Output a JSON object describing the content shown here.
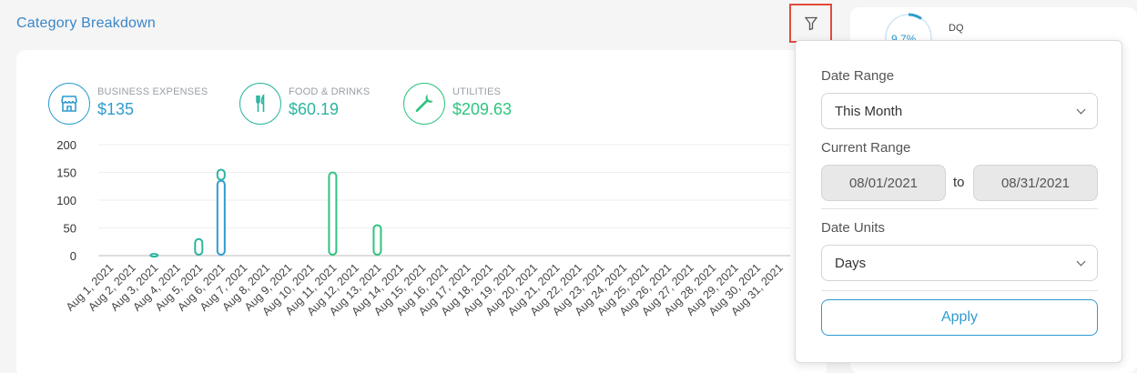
{
  "section_title": "Category Breakdown",
  "summary": [
    {
      "label": "BUSINESS EXPENSES",
      "value": "$135",
      "icon": "store-icon"
    },
    {
      "label": "FOOD & DRINKS",
      "value": "$60.19",
      "icon": "fork-knife-icon"
    },
    {
      "label": "UTILITIES",
      "value": "$209.63",
      "icon": "wrench-icon"
    }
  ],
  "colors": {
    "business": "#2e9ccf",
    "food": "#2bb5a0",
    "utilities": "#2ec47e",
    "accent": "#3a86c8"
  },
  "right_card": {
    "percent": "9.7%",
    "label": "DQ"
  },
  "filter": {
    "date_range_label": "Date Range",
    "date_range_value": "This Month",
    "current_range_label": "Current Range",
    "start_date": "08/01/2021",
    "to_label": "to",
    "end_date": "08/31/2021",
    "date_units_label": "Date Units",
    "date_units_value": "Days",
    "apply_label": "Apply"
  },
  "chart_data": {
    "type": "bar",
    "ylim": [
      0,
      200
    ],
    "yticks": [
      0,
      50,
      100,
      150,
      200
    ],
    "categories": [
      "Aug 1, 2021",
      "Aug 2, 2021",
      "Aug 3, 2021",
      "Aug 4, 2021",
      "Aug 5, 2021",
      "Aug 6, 2021",
      "Aug 7, 2021",
      "Aug 8, 2021",
      "Aug 9, 2021",
      "Aug 10, 2021",
      "Aug 11, 2021",
      "Aug 12, 2021",
      "Aug 13, 2021",
      "Aug 14, 2021",
      "Aug 15, 2021",
      "Aug 16, 2021",
      "Aug 17, 2021",
      "Aug 18, 2021",
      "Aug 19, 2021",
      "Aug 20, 2021",
      "Aug 21, 2021",
      "Aug 22, 2021",
      "Aug 23, 2021",
      "Aug 24, 2021",
      "Aug 25, 2021",
      "Aug 26, 2021",
      "Aug 27, 2021",
      "Aug 28, 2021",
      "Aug 29, 2021",
      "Aug 30, 2021",
      "Aug 31, 2021"
    ],
    "stacked": true,
    "series": [
      {
        "name": "BUSINESS EXPENSES",
        "color": "#2e9ccf",
        "values": [
          0,
          0,
          0,
          0,
          0,
          135,
          0,
          0,
          0,
          0,
          0,
          0,
          0,
          0,
          0,
          0,
          0,
          0,
          0,
          0,
          0,
          0,
          0,
          0,
          0,
          0,
          0,
          0,
          0,
          0,
          0
        ]
      },
      {
        "name": "FOOD & DRINKS",
        "color": "#2bb5a0",
        "values": [
          0,
          0,
          3,
          0,
          30,
          20,
          0,
          0,
          0,
          0,
          0,
          0,
          0,
          0,
          0,
          0,
          0,
          0,
          0,
          0,
          0,
          0,
          0,
          0,
          0,
          0,
          0,
          0,
          0,
          0,
          0
        ]
      },
      {
        "name": "UTILITIES",
        "color": "#2ec47e",
        "values": [
          0,
          0,
          0,
          0,
          0,
          0,
          0,
          0,
          0,
          0,
          150,
          0,
          55,
          0,
          0,
          0,
          0,
          0,
          0,
          0,
          0,
          0,
          0,
          0,
          0,
          0,
          0,
          0,
          0,
          0,
          0
        ]
      }
    ]
  }
}
